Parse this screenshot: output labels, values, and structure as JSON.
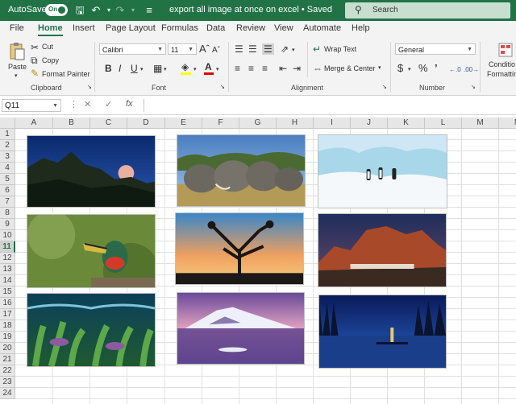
{
  "titlebar": {
    "autosave_label": "AutoSave",
    "autosave_state": "On",
    "doc_title": "export all image at once on excel  •  Saved",
    "search_placeholder": "Search"
  },
  "tabs": [
    "File",
    "Home",
    "Insert",
    "Page Layout",
    "Formulas",
    "Data",
    "Review",
    "View",
    "Automate",
    "Help"
  ],
  "active_tab": "Home",
  "ribbon": {
    "paste": "Paste",
    "cut": "Cut",
    "copy": "Copy",
    "format_painter": "Format Painter",
    "clipboard": "Clipboard",
    "font_name": "Calibri",
    "font_size": "11",
    "font": "Font",
    "wrap_text": "Wrap Text",
    "merge_center": "Merge & Center",
    "alignment": "Alignment",
    "number_format": "General",
    "number": "Number",
    "conditional_1": "Conditio",
    "conditional_2": "Formattin"
  },
  "formula_bar": {
    "name_box": "Q11",
    "fx": "fx"
  },
  "columns": [
    "A",
    "B",
    "C",
    "D",
    "E",
    "F",
    "G",
    "H",
    "I",
    "J",
    "K",
    "L",
    "M",
    "N"
  ],
  "rows": [
    "1",
    "2",
    "3",
    "4",
    "5",
    "6",
    "7",
    "8",
    "9",
    "10",
    "11",
    "12",
    "13",
    "14",
    "15",
    "16",
    "17",
    "18",
    "19",
    "20",
    "21",
    "22",
    "23",
    "24"
  ],
  "selected_row": "11",
  "images": [
    {
      "subject": "moonrise-over-hills"
    },
    {
      "subject": "elephant-herd"
    },
    {
      "subject": "penguins-on-ice"
    },
    {
      "subject": "toucan-bird"
    },
    {
      "subject": "joshua-tree-sunset"
    },
    {
      "subject": "red-rock-village"
    },
    {
      "subject": "aquatic-plants-underwater"
    },
    {
      "subject": "snowy-mountain-lake"
    },
    {
      "subject": "night-lake-lighthouse"
    }
  ],
  "colors": {
    "excel_green": "#217346",
    "ribbon_bg": "#f3f3f3"
  }
}
